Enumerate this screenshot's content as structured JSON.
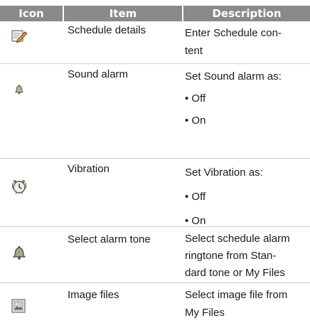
{
  "table": {
    "headers": {
      "icon": "Icon",
      "item": "Item",
      "description": "Description"
    },
    "rows": [
      {
        "icon": "notepad-pencil-icon",
        "item": "Schedule details",
        "description": [
          " Enter Schedule con-",
          "tent"
        ]
      },
      {
        "icon": "bell-small-icon",
        "item": "Sound alarm",
        "description": [
          "Set Sound alarm as:",
          "• Off",
          "• On"
        ]
      },
      {
        "icon": "vibration-alarm-clock-icon",
        "item": "Vibration",
        "description": [
          "Set Vibration as:",
          "• Off",
          "• On"
        ]
      },
      {
        "icon": "bell-icon",
        "item": "Select alarm tone",
        "description": [
          "Select schedule alarm",
          "ringtone from Stan-",
          "dard tone or My Files"
        ]
      },
      {
        "icon": "image-file-icon",
        "item": "Image files",
        "description": [
          "Select image file from",
          "My Files"
        ]
      }
    ]
  }
}
